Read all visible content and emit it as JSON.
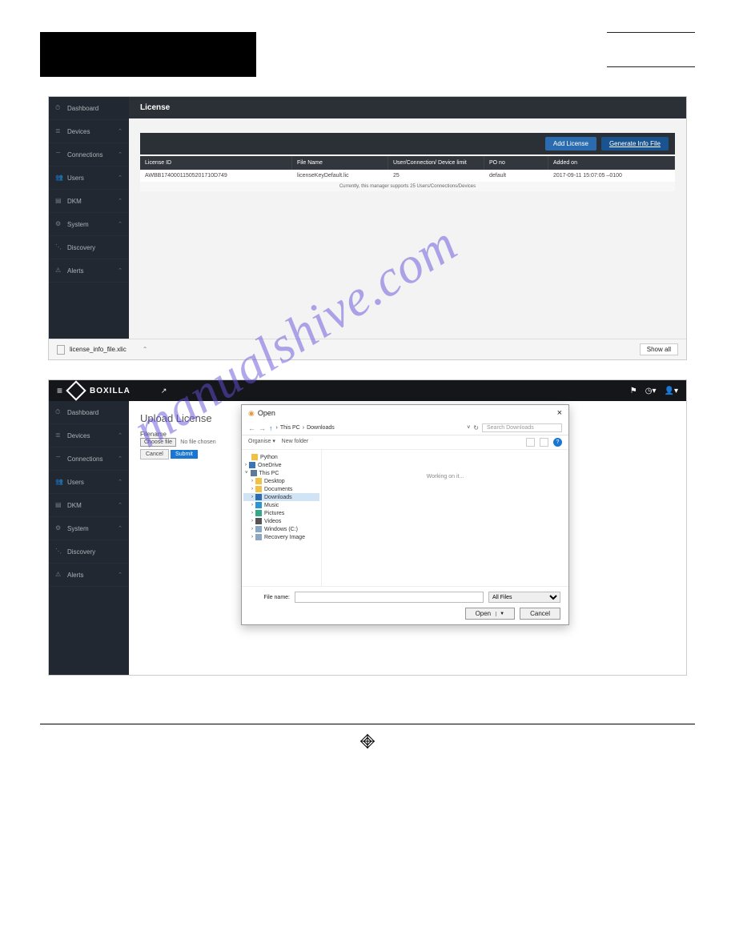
{
  "sidebar": {
    "items": [
      {
        "label": "Dashboard",
        "icon": "gauge",
        "chev": false
      },
      {
        "label": "Devices",
        "icon": "server",
        "chev": true
      },
      {
        "label": "Connections",
        "icon": "wifi",
        "chev": true
      },
      {
        "label": "Users",
        "icon": "users",
        "chev": true
      },
      {
        "label": "DKM",
        "icon": "dkm",
        "chev": true
      },
      {
        "label": "System",
        "icon": "gear",
        "chev": true
      },
      {
        "label": "Discovery",
        "icon": "discovery",
        "chev": false
      },
      {
        "label": "Alerts",
        "icon": "alert",
        "chev": true
      }
    ]
  },
  "screenshot1": {
    "title": "License",
    "buttons": {
      "add": "Add License",
      "generate": "Generate Info File"
    },
    "columns": {
      "c1": "License ID",
      "c2": "File Name",
      "c3": "User/Connection/\nDevice limit",
      "c4": "PO no",
      "c5": "Added on"
    },
    "row": {
      "c1": "AWBB17400011505201710D749",
      "c2": "licenseKeyDefault.lic",
      "c3": "25",
      "c4": "default",
      "c5": "2017-09-11 15:07:05 –0100"
    },
    "summary": "Currently, this manager supports 25 Users/Connections/Devices",
    "download_file": "license_info_file.xlic",
    "showall": "Show all"
  },
  "screenshot2": {
    "brand": "BOXILLA",
    "title": "Upload License",
    "filename_label": "Filename",
    "choose_file": "Choose file",
    "no_file": "No file chosen",
    "cancel": "Cancel",
    "submit": "Submit",
    "dialog": {
      "title": "Open",
      "breadcrumb": {
        "root": "This PC",
        "sep": "›",
        "folder": "Downloads"
      },
      "search_placeholder": "Search Downloads",
      "organise": "Organise",
      "newfolder": "New folder",
      "tree": [
        {
          "label": "Python",
          "type": "folder",
          "indent": 1
        },
        {
          "label": "OneDrive",
          "type": "cloud",
          "indent": 0
        },
        {
          "label": "This PC",
          "type": "pc",
          "indent": 0,
          "expanded": true
        },
        {
          "label": "Desktop",
          "type": "folder",
          "indent": 1
        },
        {
          "label": "Documents",
          "type": "folder",
          "indent": 1
        },
        {
          "label": "Downloads",
          "type": "folder",
          "indent": 1,
          "selected": true
        },
        {
          "label": "Music",
          "type": "music",
          "indent": 1
        },
        {
          "label": "Pictures",
          "type": "pic",
          "indent": 1
        },
        {
          "label": "Videos",
          "type": "vid",
          "indent": 1
        },
        {
          "label": "Windows (C:)",
          "type": "drive",
          "indent": 1
        },
        {
          "label": "Recovery Image",
          "type": "drive",
          "indent": 1
        }
      ],
      "working": "Working on it...",
      "filename_label": "File name:",
      "filter": "All Files",
      "open": "Open",
      "cancel": "Cancel"
    }
  },
  "watermark": "manualshive.com"
}
